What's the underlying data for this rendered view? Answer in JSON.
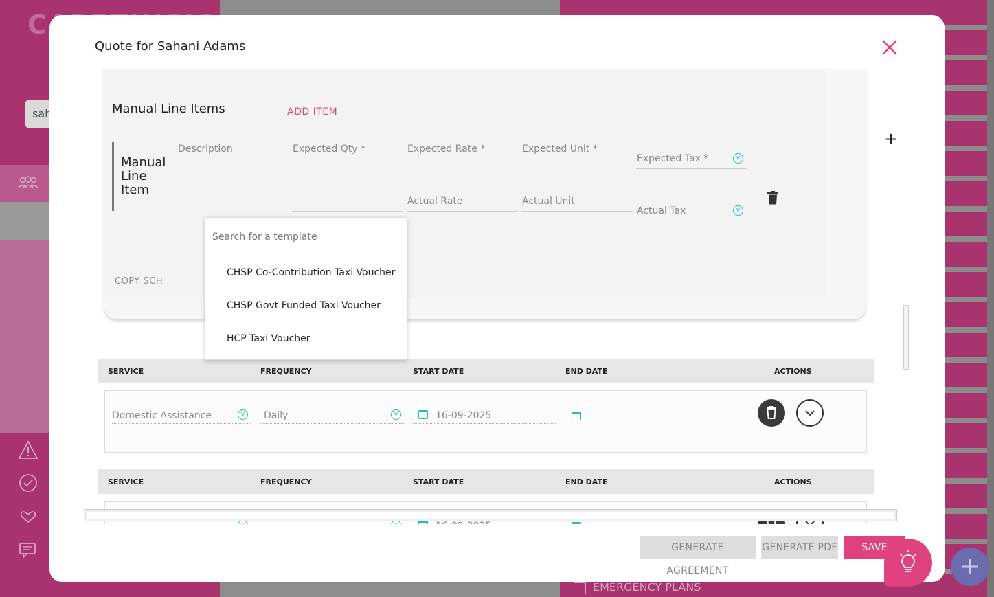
{
  "background": {
    "logo_text": "CARETHISION",
    "search_value": "sah",
    "emergency_label": "EMERGENCY PLANS"
  },
  "modal": {
    "title": "Quote for Sahani Adams",
    "close_glyph": "×",
    "plus_glyph": "+"
  },
  "manual": {
    "section_title": "Manual Line Items",
    "add_item_label": "ADD ITEM",
    "item_label": "Manual Line Item",
    "fields_row1": [
      "Description",
      "Expected Qty *",
      "Expected Rate *",
      "Expected Unit *",
      "Expected Tax *"
    ],
    "fields_row2": [
      "Actual Rate",
      "Actual Unit",
      "Actual Tax"
    ],
    "copy_label": "COPY SCH"
  },
  "template_dropdown": {
    "placeholder": "Search for a template",
    "options": [
      "CHSP Co-Contribution Taxi Voucher",
      "CHSP Govt Funded Taxi Voucher",
      "HCP Taxi Voucher"
    ]
  },
  "services": {
    "headers": [
      "SERVICE",
      "FREQUENCY",
      "START DATE",
      "END DATE",
      "ACTIONS"
    ],
    "rows": [
      {
        "service": "Domestic Assistance",
        "frequency": "Daily",
        "start_date": "16-09-2025",
        "end_date": ""
      }
    ],
    "row2_start_date_partial": "16-09-2025"
  },
  "footer": {
    "generate_agreement": "GENERATE AGREEMENT",
    "generate_pdf": "GENERATE PDF",
    "save": "SAVE"
  },
  "colors": {
    "accent": "#e0417f",
    "teal": "#27b7c9",
    "brand_bg": "#a8336f",
    "fab": "#6b6bb0"
  }
}
